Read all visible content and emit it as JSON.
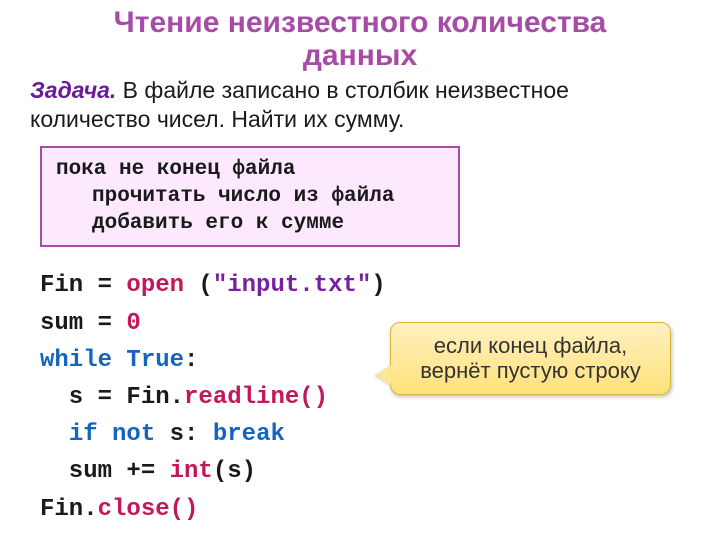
{
  "title_line1": "Чтение неизвестного количества",
  "title_line2": "данных",
  "task": {
    "label": "Задача.",
    "text": " В файле записано в столбик неизвестное количество чисел. Найти их сумму."
  },
  "pseudo": {
    "line1": "пока не конец файла",
    "line2": "прочитать число из файла",
    "line3": "добавить его к сумме"
  },
  "code": {
    "l1_a": "Fin = ",
    "l1_b": "open",
    "l1_c": " (",
    "l1_d": "\"input.txt\"",
    "l1_e": ")",
    "l2_a": "sum = ",
    "l2_b": "0",
    "l3_a": "while",
    "l3_b": " ",
    "l3_c": "True",
    "l3_d": ":",
    "l4_a": "  s = Fin.",
    "l4_b": "readline()",
    "l5_a": "  ",
    "l5_b": "if",
    "l5_c": " ",
    "l5_d": "not",
    "l5_e": " s: ",
    "l5_f": "break",
    "l6_a": "  sum += ",
    "l6_b": "int",
    "l6_c": "(s)",
    "l7_a": "Fin.",
    "l7_b": "close()"
  },
  "callout": "если конец файла, вернёт пустую строку"
}
